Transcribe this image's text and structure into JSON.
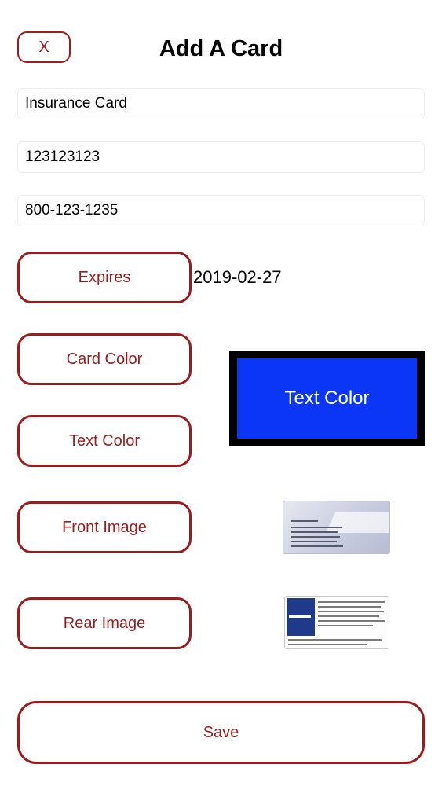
{
  "header": {
    "close_label": "X",
    "title": "Add A Card"
  },
  "fields": {
    "card_name": "Insurance Card",
    "card_number": "123123123",
    "phone_number": "800-123-1235"
  },
  "buttons": {
    "expires": "Expires",
    "card_color": "Card Color",
    "text_color": "Text Color",
    "front_image": "Front Image",
    "rear_image": "Rear Image",
    "save": "Save"
  },
  "expires_value": "2019-02-27",
  "preview": {
    "label": "Text Color",
    "card_color": "#0b36f5",
    "text_color": "#ffffff",
    "border_color": "#000000"
  },
  "colors": {
    "accent": "#9b1c1c"
  },
  "images": {
    "front": "insurance-card-front-image",
    "rear": "insurance-card-rear-image"
  }
}
